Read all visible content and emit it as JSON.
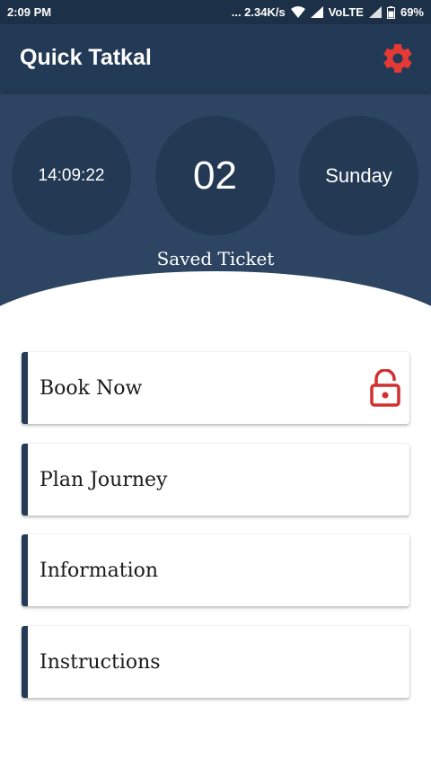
{
  "status_bar": {
    "time": "2:09 PM",
    "network_speed": "... 2.34K/s",
    "network_type": "VoLTE",
    "battery": "69%"
  },
  "app_bar": {
    "title": "Quick Tatkal",
    "settings_icon": "gear-icon",
    "settings_color": "#e53935"
  },
  "header": {
    "time": "14:09:22",
    "saved_count": "02",
    "day": "Sunday",
    "saved_label": "Saved Ticket"
  },
  "menu": {
    "items": [
      {
        "label": "Book Now",
        "icon": "unlock-icon"
      },
      {
        "label": "Plan Journey"
      },
      {
        "label": "Information"
      },
      {
        "label": "Instructions"
      }
    ]
  },
  "colors": {
    "app_bar": "#233a56",
    "header": "#2d4562",
    "accent_red": "#d32f2f"
  }
}
